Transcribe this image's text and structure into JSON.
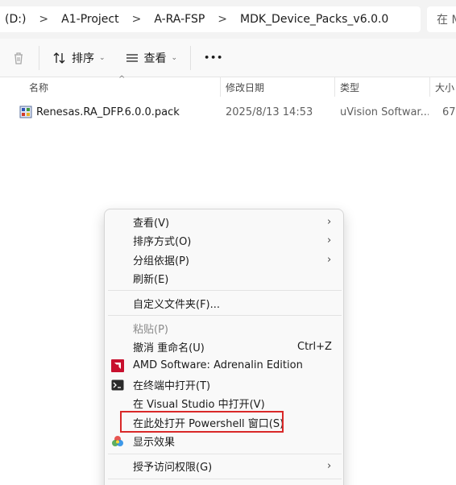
{
  "address": {
    "crumbs": [
      "(D:)",
      "A1-Project",
      "A-RA-FSP",
      "MDK_Device_Packs_v6.0.0"
    ],
    "separator": ">",
    "search_text": "在 M"
  },
  "toolbar": {
    "sort_label": "排序",
    "view_label": "查看",
    "more_label": "•••"
  },
  "columns": {
    "name": "名称",
    "date": "修改日期",
    "type": "类型",
    "size": "大小"
  },
  "file": {
    "name": "Renesas.RA_DFP.6.0.0.pack",
    "date": "2025/8/13 14:53",
    "type": "uVision Softwar...",
    "size": "67,"
  },
  "menu": {
    "view": "查看(V)",
    "sort_by": "排序方式(O)",
    "group_by": "分组依据(P)",
    "refresh": "刷新(E)",
    "customize": "自定义文件夹(F)...",
    "paste": "粘贴(P)",
    "undo_rename": "撤消 重命名(U)",
    "undo_shortcut": "Ctrl+Z",
    "amd": "AMD Software: Adrenalin Edition",
    "terminal": "在终端中打开(T)",
    "visual_studio": "在 Visual Studio 中打开(V)",
    "powershell": "在此处打开 Powershell 窗口(S)",
    "display": "显示效果",
    "grant_access": "授予访问权限(G)"
  },
  "colors": {
    "highlight_border": "#d92828",
    "amd_red": "#c8102e"
  }
}
